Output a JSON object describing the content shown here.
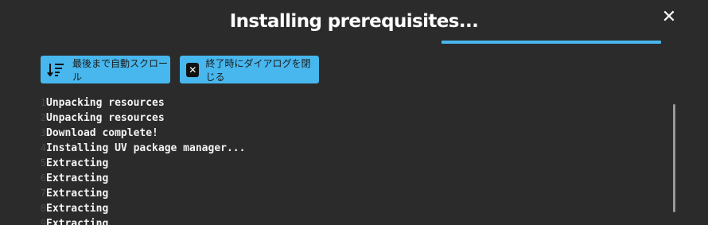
{
  "dialog": {
    "title": "Installing prerequisites...",
    "close_icon": "close-icon",
    "close_glyph": "✕",
    "progress": 1.0
  },
  "toolbar": {
    "autoscroll_label": "最後まで自動スクロール",
    "autoscroll_icon": "sort-descending-icon",
    "close_on_done_label": "終了時にダイアログを閉じる",
    "close_on_done_icon": "checkbox-checked-icon",
    "close_on_done_glyph": "✕"
  },
  "colors": {
    "accent": "#47b7ee",
    "background": "#2b2b2b"
  },
  "log": {
    "lines": [
      {
        "num": "1",
        "text": "Unpacking resources"
      },
      {
        "num": "2",
        "text": "Unpacking resources"
      },
      {
        "num": "3",
        "text": "Download complete!"
      },
      {
        "num": "4",
        "text": "Installing UV package manager..."
      },
      {
        "num": "5",
        "text": "Extracting"
      },
      {
        "num": "6",
        "text": "Extracting"
      },
      {
        "num": "7",
        "text": "Extracting"
      },
      {
        "num": "8",
        "text": "Extracting"
      },
      {
        "num": "9",
        "text": "Extracting"
      }
    ]
  }
}
